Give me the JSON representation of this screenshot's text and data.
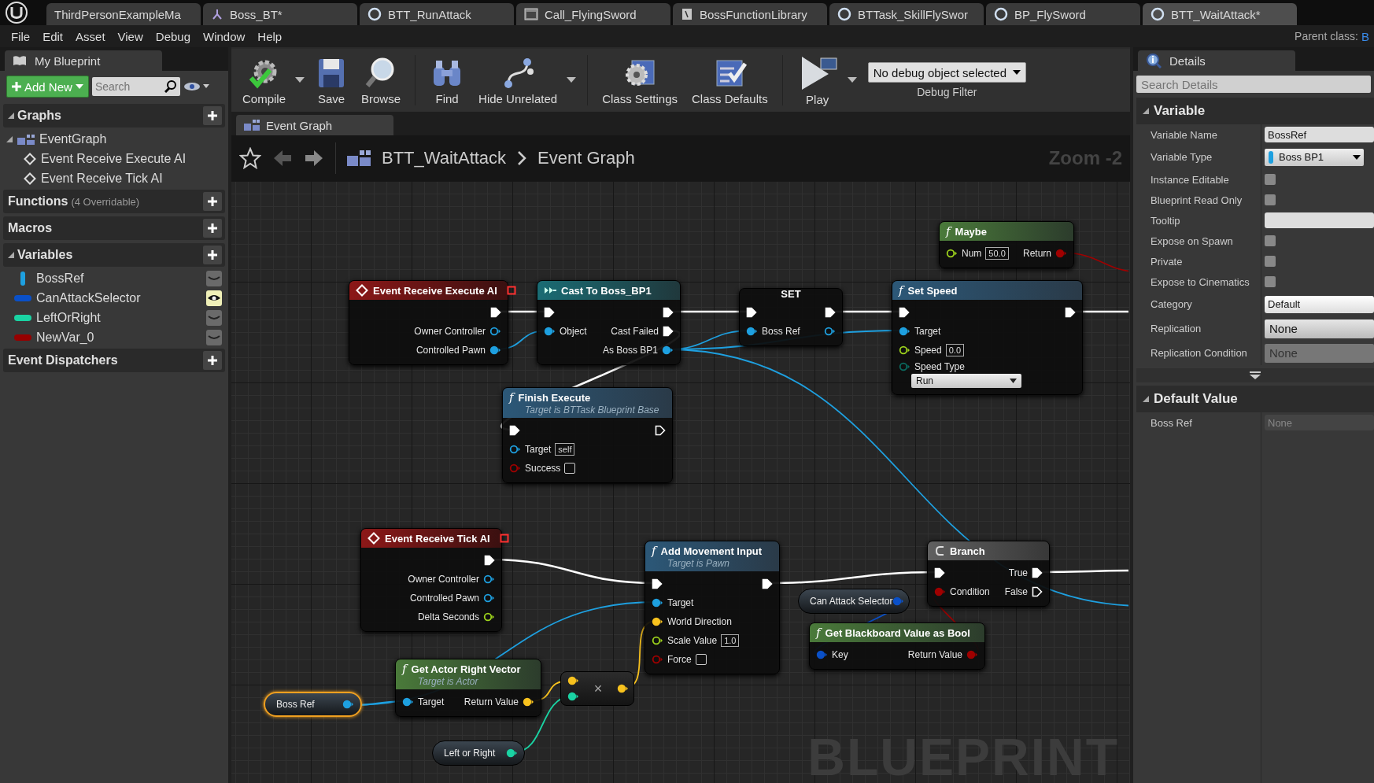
{
  "tabs": [
    {
      "label": "ThirdPersonExampleMa",
      "kind": "level",
      "selected": false
    },
    {
      "label": "Boss_BT*",
      "kind": "tree",
      "selected": false
    },
    {
      "label": "BTT_RunAttack",
      "kind": "blueprint",
      "selected": false
    },
    {
      "label": "Call_FlyingSword",
      "kind": "widget",
      "selected": false
    },
    {
      "label": "BossFunctionLibrary",
      "kind": "library",
      "selected": false
    },
    {
      "label": "BTTask_SkillFlySwor",
      "kind": "blueprint",
      "selected": false
    },
    {
      "label": "BP_FlySword",
      "kind": "blueprint",
      "selected": false
    },
    {
      "label": "BTT_WaitAttack*",
      "kind": "blueprint",
      "selected": true
    }
  ],
  "menu": [
    "File",
    "Edit",
    "Asset",
    "View",
    "Debug",
    "Window",
    "Help"
  ],
  "parent_class": {
    "label": "Parent class:",
    "value": "B"
  },
  "my_blueprint": {
    "title": "My Blueprint",
    "add_button": "Add New",
    "search": {
      "placeholder": "Search"
    },
    "sections": [
      {
        "title": "Graphs",
        "expanded": true,
        "items": [
          {
            "label": "EventGraph",
            "kind": "graph",
            "children": [
              {
                "label": "Event Receive Execute AI",
                "kind": "event"
              },
              {
                "label": "Event Receive Tick AI",
                "kind": "event"
              }
            ]
          }
        ]
      },
      {
        "title": "Functions",
        "note": "(4 Overridable)",
        "expanded": false
      },
      {
        "title": "Macros",
        "expanded": false
      },
      {
        "title": "Variables",
        "expanded": true,
        "items": [
          {
            "label": "BossRef",
            "kind": "object",
            "color": "#1ea0e0",
            "public": false
          },
          {
            "label": "CanAttackSelector",
            "kind": "value",
            "color": "#0a50c8",
            "public": true
          },
          {
            "label": "LeftOrRight",
            "kind": "value",
            "color": "#1ad3a3",
            "public": false
          },
          {
            "label": "NewVar_0",
            "kind": "value",
            "color": "#960000",
            "public": false
          }
        ]
      },
      {
        "title": "Event Dispatchers",
        "expanded": false
      }
    ]
  },
  "toolbar": [
    {
      "label": "Compile",
      "kind": "compile",
      "dropdown": true
    },
    {
      "label": "Save",
      "kind": "save",
      "dropdown": false
    },
    {
      "label": "Browse",
      "kind": "browse",
      "dropdown": false
    },
    {
      "label": "Find",
      "kind": "find",
      "dropdown": false
    },
    {
      "label": "Hide Unrelated",
      "kind": "hide",
      "dropdown": true
    },
    {
      "label": "Class Settings",
      "kind": "settings",
      "dropdown": false
    },
    {
      "label": "Class Defaults",
      "kind": "defaults",
      "dropdown": false
    },
    {
      "label": "Play",
      "kind": "play",
      "dropdown": true
    }
  ],
  "debug_filter": {
    "value": "No debug object selected",
    "label": "Debug Filter"
  },
  "graph_tab": {
    "label": "Event Graph",
    "selected": true
  },
  "breadcrumb": {
    "blueprint": "BTT_WaitAttack",
    "graph": "Event Graph",
    "zoom": "Zoom -2"
  },
  "watermark": "BLUEPRINT",
  "nodes": [
    {
      "kind": "event",
      "title": "Event Receive Execute AI",
      "rows": [
        {
          "out": {
            "kind": "exec",
            "connected": true
          }
        },
        {
          "out": {
            "kind": "data",
            "label": "Owner Controller",
            "color": "#1ea0e0",
            "connected": false
          }
        },
        {
          "out": {
            "kind": "data",
            "label": "Controlled Pawn",
            "color": "#1ea0e0",
            "connected": true
          }
        }
      ]
    },
    {
      "kind": "cast",
      "title": "Cast To Boss_BP1",
      "rows": [
        {
          "in": {
            "kind": "exec",
            "connected": true
          },
          "out": {
            "kind": "exec",
            "connected": true
          }
        },
        {
          "in": {
            "kind": "data",
            "label": "Object",
            "color": "#1ea0e0",
            "connected": true
          },
          "out": {
            "kind": "exec",
            "label": "Cast Failed",
            "connected": true
          }
        },
        {
          "out": {
            "kind": "data",
            "label": "As Boss BP1",
            "color": "#1ea0e0",
            "connected": true
          }
        }
      ]
    },
    {
      "kind": "set",
      "title": "SET",
      "rows": [
        {
          "in": {
            "kind": "exec",
            "connected": true
          },
          "out": {
            "kind": "exec",
            "connected": true
          }
        },
        {
          "in": {
            "kind": "data",
            "label": "Boss Ref",
            "color": "#1ea0e0",
            "connected": true
          },
          "out": {
            "kind": "data",
            "color": "#1ea0e0",
            "connected": false
          }
        }
      ]
    },
    {
      "kind": "function",
      "icon": "f",
      "title": "Set Speed",
      "rows": [
        {
          "in": {
            "kind": "exec",
            "connected": true
          },
          "out": {
            "kind": "exec",
            "connected": true
          }
        },
        {
          "in": {
            "kind": "data",
            "label": "Target",
            "color": "#1ea0e0",
            "connected": true
          }
        },
        {
          "in": {
            "kind": "data",
            "label": "Speed",
            "color": "#9ed41c",
            "connected": false,
            "field": {
              "kind": "text",
              "value": "0.0"
            }
          }
        },
        {
          "in": {
            "kind": "data",
            "label": "Speed Type",
            "color": "#0a6b60",
            "connected": false,
            "field": {
              "kind": "dropdown",
              "value": "Run"
            }
          }
        }
      ]
    },
    {
      "kind": "pure",
      "icon": "f",
      "title": "Maybe",
      "rows": [
        {
          "in": {
            "kind": "data",
            "label": "Num",
            "color": "#9ed41c",
            "connected": false,
            "field": {
              "kind": "text",
              "value": "50.0"
            }
          },
          "out": {
            "kind": "data",
            "label": "Return",
            "color": "#a00000",
            "connected": true
          }
        }
      ]
    },
    {
      "kind": "function",
      "icon": "f",
      "title": "Finish Execute",
      "subtitle": "Target is BTTask Blueprint Base",
      "rows": [
        {
          "in": {
            "kind": "exec",
            "connected": true
          },
          "out": {
            "kind": "exec",
            "connected": false
          }
        },
        {
          "in": {
            "kind": "data",
            "label": "Target",
            "color": "#1ea0e0",
            "connected": false,
            "field": {
              "kind": "text",
              "value": "self"
            }
          }
        },
        {
          "in": {
            "kind": "data",
            "label": "Success",
            "color": "#a00000",
            "connected": false,
            "field": {
              "kind": "checkbox",
              "checked": false
            }
          }
        }
      ]
    },
    {
      "kind": "event",
      "title": "Event Receive Tick AI",
      "rows": [
        {
          "out": {
            "kind": "exec",
            "connected": true
          }
        },
        {
          "out": {
            "kind": "data",
            "label": "Owner Controller",
            "color": "#1ea0e0",
            "connected": false
          }
        },
        {
          "out": {
            "kind": "data",
            "label": "Controlled Pawn",
            "color": "#1ea0e0",
            "connected": false
          }
        },
        {
          "out": {
            "kind": "data",
            "label": "Delta Seconds",
            "color": "#9ed41c",
            "connected": false
          }
        }
      ]
    },
    {
      "kind": "function",
      "icon": "f",
      "title": "Add Movement Input",
      "subtitle": "Target is Pawn",
      "rows": [
        {
          "in": {
            "kind": "exec",
            "connected": true
          },
          "out": {
            "kind": "exec",
            "connected": true
          }
        },
        {
          "in": {
            "kind": "data",
            "label": "Target",
            "color": "#1ea0e0",
            "connected": true
          }
        },
        {
          "in": {
            "kind": "data",
            "label": "World Direction",
            "color": "#f8c21e",
            "connected": true
          }
        },
        {
          "in": {
            "kind": "data",
            "label": "Scale Value",
            "color": "#9ed41c",
            "connected": false,
            "field": {
              "kind": "text",
              "value": "1.0"
            }
          }
        },
        {
          "in": {
            "kind": "data",
            "label": "Force",
            "color": "#a00000",
            "connected": false,
            "field": {
              "kind": "checkbox",
              "checked": false
            }
          }
        }
      ]
    },
    {
      "kind": "branch",
      "title": "Branch",
      "rows": [
        {
          "in": {
            "kind": "exec",
            "connected": true
          },
          "out": {
            "kind": "exec",
            "label": "True",
            "connected": true
          }
        },
        {
          "in": {
            "kind": "data",
            "label": "Condition",
            "color": "#a00000",
            "connected": true
          },
          "out": {
            "kind": "exec",
            "label": "False",
            "connected": false
          }
        }
      ]
    },
    {
      "kind": "variable",
      "title": "Can Attack Selector",
      "selected": false,
      "pin": {
        "kind": "data",
        "color": "#0a50c8",
        "connected": true
      }
    },
    {
      "kind": "pure",
      "icon": "f",
      "title": "Get Blackboard Value as Bool",
      "rows": [
        {
          "in": {
            "kind": "data",
            "label": "Key",
            "color": "#0a50c8",
            "connected": true
          },
          "out": {
            "kind": "data",
            "label": "Return Value",
            "color": "#a00000",
            "connected": true
          }
        }
      ]
    },
    {
      "kind": "pure",
      "icon": "f",
      "title": "Get Actor Right Vector",
      "subtitle": "Target is Actor",
      "rows": [
        {
          "in": {
            "kind": "data",
            "label": "Target",
            "color": "#1ea0e0",
            "connected": true
          },
          "out": {
            "kind": "data",
            "label": "Return Value",
            "color": "#f8c21e",
            "connected": true
          }
        }
      ]
    },
    {
      "kind": "operator",
      "title": "×",
      "inputs": [
        {
          "kind": "data",
          "color": "#f8c21e",
          "connected": true
        },
        {
          "kind": "data",
          "color": "#1ad3a3",
          "connected": true
        }
      ],
      "pin": {
        "kind": "data",
        "color": "#f8c21e",
        "connected": true
      }
    },
    {
      "kind": "variable",
      "title": "Boss Ref",
      "selected": true,
      "pin": {
        "kind": "data",
        "color": "#1ea0e0",
        "connected": true
      }
    },
    {
      "kind": "variable",
      "title": "Left or Right",
      "selected": false,
      "pin": {
        "kind": "data",
        "color": "#1ad3a3",
        "connected": true
      }
    }
  ],
  "details": {
    "title": "Details",
    "search": {
      "placeholder": "Search Details"
    },
    "sections": [
      {
        "title": "Variable",
        "expanded": true,
        "advanced": true,
        "rows": [
          {
            "label": "Variable Name",
            "kind": "text",
            "value": "BossRef",
            "disabled": false
          },
          {
            "label": "Variable Type",
            "kind": "type",
            "value": "Boss BP1"
          },
          {
            "label": "Instance Editable",
            "kind": "checkbox",
            "checked": false
          },
          {
            "label": "Blueprint Read Only",
            "kind": "checkbox",
            "checked": false
          },
          {
            "label": "Tooltip",
            "kind": "text",
            "disabled": false
          },
          {
            "label": "Expose on Spawn",
            "kind": "checkbox",
            "checked": false
          },
          {
            "label": "Private",
            "kind": "checkbox",
            "checked": false
          },
          {
            "label": "Expose to Cinematics",
            "kind": "checkbox",
            "checked": false
          },
          {
            "label": "Category",
            "kind": "combo",
            "value": "Default"
          },
          {
            "label": "Replication",
            "kind": "dropdown",
            "value": "None",
            "disabled": false
          },
          {
            "label": "Replication Condition",
            "kind": "dropdown",
            "value": "None",
            "disabled": true
          }
        ]
      },
      {
        "title": "Default Value",
        "expanded": true,
        "advanced": false,
        "rows": [
          {
            "label": "Boss Ref",
            "kind": "text",
            "value": "None",
            "disabled": true
          }
        ]
      }
    ]
  }
}
